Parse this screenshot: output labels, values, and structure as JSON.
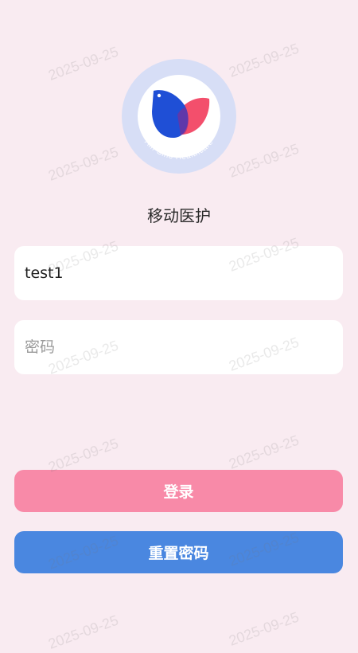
{
  "app": {
    "title": "移动医护",
    "logo_text": "Am-Sino Healthcare"
  },
  "watermark": {
    "text": "2025-09-25"
  },
  "login_form": {
    "username_value": "test1",
    "password_placeholder": "密码",
    "login_label": "登录",
    "reset_password_label": "重置密码"
  },
  "colors": {
    "background": "#f9ebf1",
    "login_button": "#f88aa8",
    "reset_button": "#4a87e0",
    "logo_ring": "#d7def6",
    "logo_blue": "#1f4fd6",
    "logo_red": "#f2405f"
  }
}
